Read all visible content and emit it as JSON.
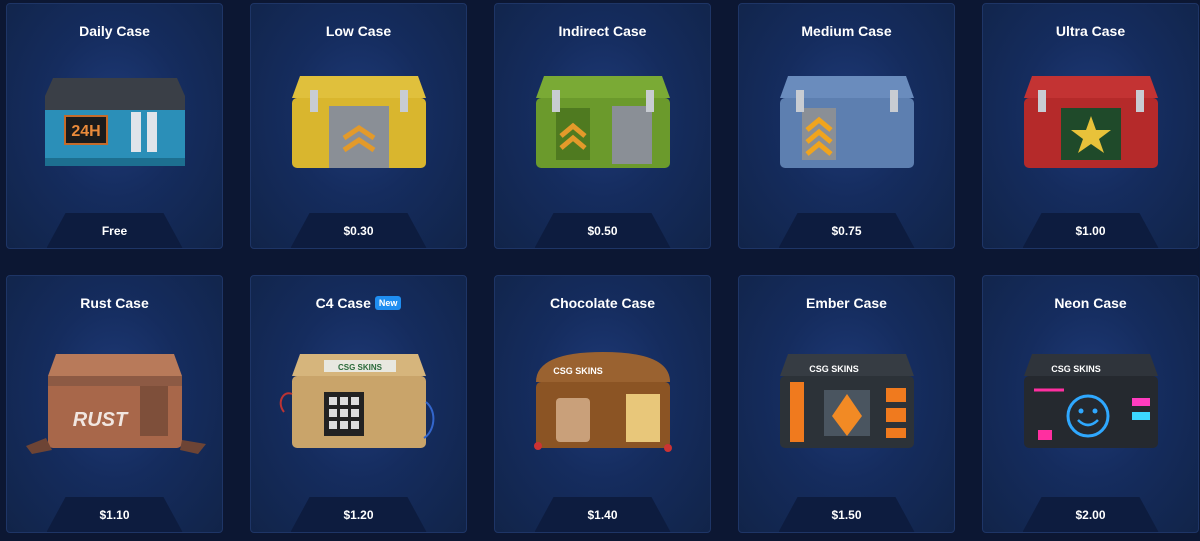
{
  "cases": [
    {
      "name": "Daily Case",
      "price": "Free",
      "color": "#2b8fb8",
      "lid": "#3a3f47",
      "icon": "timer-24h-icon",
      "label": "24H"
    },
    {
      "name": "Low Case",
      "price": "$0.30",
      "color": "#d9b62e",
      "lid": "#e0c03c",
      "icon": "chevron-rank-icon"
    },
    {
      "name": "Indirect Case",
      "price": "$0.50",
      "color": "#6b9a2c",
      "lid": "#7aaa35",
      "icon": "chevron-rank-icon"
    },
    {
      "name": "Medium Case",
      "price": "$0.75",
      "color": "#5d7fb0",
      "lid": "#6a8cbd",
      "icon": "chevron-rank-icon"
    },
    {
      "name": "Ultra Case",
      "price": "$1.00",
      "color": "#b52a2a",
      "lid": "#c33333",
      "icon": "star-icon"
    },
    {
      "name": "Rust Case",
      "price": "$1.10",
      "color": "#a8674a",
      "lid": "#b87a5a",
      "icon": "rust-graffiti-icon",
      "label": "RUST"
    },
    {
      "name": "C4 Case",
      "price": "$1.20",
      "color": "#c9a46a",
      "lid": "#d6b57c",
      "icon": "keypad-icon",
      "badge": "New",
      "brand": "CSG SKINS"
    },
    {
      "name": "Chocolate Case",
      "price": "$1.40",
      "color": "#8b5424",
      "lid": "#9a6230",
      "icon": "barrel-icon",
      "brand": "CSG SKINS"
    },
    {
      "name": "Ember Case",
      "price": "$1.50",
      "color": "#2c3238",
      "lid": "#363c43",
      "icon": "flame-panel-icon",
      "brand": "CSG SKINS"
    },
    {
      "name": "Neon Case",
      "price": "$2.00",
      "color": "#25292f",
      "lid": "#2f343b",
      "icon": "smiley-icon",
      "brand": "CSG SKINS"
    }
  ]
}
